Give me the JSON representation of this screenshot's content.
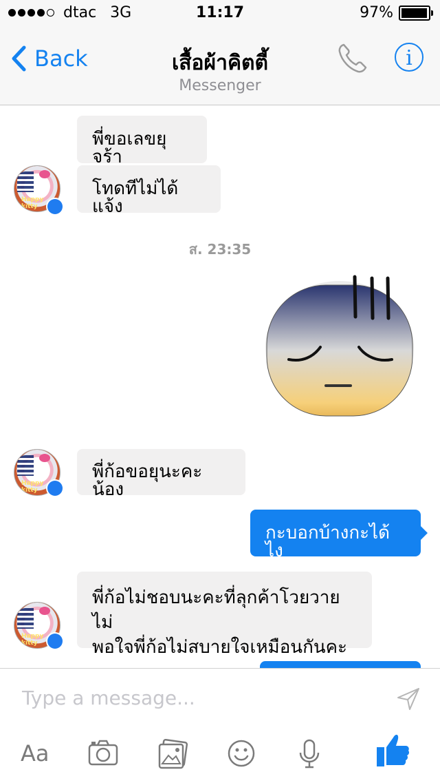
{
  "status_bar": {
    "carrier": "dtac",
    "network": "3G",
    "time": "11:17",
    "battery": "97%"
  },
  "nav": {
    "back_label": "Back",
    "title": "เสื้อผ้าคิตตี้",
    "subtitle": "Messenger",
    "accent_color": "#1482f0"
  },
  "messages": {
    "m1": "พี่ขอเลขยุจร้า",
    "m2": "โทดทีไม่ได้แจ้ง",
    "timestamp": "ส. 23:35",
    "m3": "พี่ก้อขอยุนะคะน้อง",
    "m4": "กะบอกบ้างกะได้ไง",
    "m5_line1": "พี่ก้อไม่ชอบนะคะที่ลุกค้าโวยวายไม่",
    "m5_line2": "พอใจพี่ก้อไม่สบายใจเหมือนกันคะ"
  },
  "avatar": {
    "text": "Happy kitty"
  },
  "composer": {
    "placeholder": "Type a message...",
    "aa_label": "Aa",
    "icons": [
      "camera-icon",
      "photo-icon",
      "emoji-icon",
      "microphone-icon",
      "thumbs-up-icon"
    ]
  }
}
